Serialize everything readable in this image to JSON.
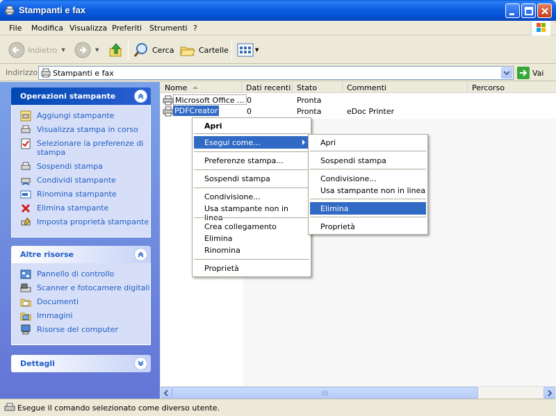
{
  "window": {
    "title": "Stampanti e fax"
  },
  "menubar": [
    "File",
    "Modifica",
    "Visualizza",
    "Preferiti",
    "Strumenti",
    "?"
  ],
  "toolbar": {
    "back": "Indietro",
    "search": "Cerca",
    "folders": "Cartelle"
  },
  "address": {
    "label": "Indirizzo",
    "value": "Stampanti e fax",
    "go": "Vai"
  },
  "taskpane": {
    "printer_tasks": {
      "title": "Operazioni stampante",
      "items": [
        "Aggiungi stampante",
        "Visualizza stampa in corso",
        "Selezionare la preferenze di stampa",
        "Sospendi stampa",
        "Condividi stampante",
        "Rinomina stampante",
        "Elimina stampante",
        "Imposta proprietà stampante"
      ]
    },
    "other_places": {
      "title": "Altre risorse",
      "items": [
        "Pannello di controllo",
        "Scanner e fotocamere digitali",
        "Documenti",
        "Immagini",
        "Risorse del computer"
      ]
    },
    "details": {
      "title": "Dettagli"
    }
  },
  "list": {
    "columns": [
      "Nome",
      "Dati recenti",
      "Stato",
      "Commenti",
      "Percorso"
    ],
    "rows": [
      {
        "name": "Microsoft Office ...",
        "docs": "0",
        "status": "Pronta",
        "comment": "",
        "location": ""
      },
      {
        "name": "PDFCreator",
        "docs": "0",
        "status": "Pronta",
        "comment": "eDoc Printer",
        "location": ""
      }
    ]
  },
  "context_menu": {
    "items": [
      "Apri",
      "Esegui come...",
      "Preferenze stampa...",
      "Sospendi stampa",
      "Condivisione...",
      "Usa stampante non in linea",
      "Crea collegamento",
      "Elimina",
      "Rinomina",
      "Proprietà"
    ]
  },
  "submenu": {
    "items": [
      "Apri",
      "Sospendi stampa",
      "Condivisione...",
      "Usa stampante non in linea",
      "Elimina",
      "Proprietà"
    ]
  },
  "status": {
    "text": "Esegue il comando selezionato come diverso utente."
  },
  "colors": {
    "titlebar": "#0550d4",
    "selection": "#316ac5",
    "task_link": "#215dc6"
  }
}
